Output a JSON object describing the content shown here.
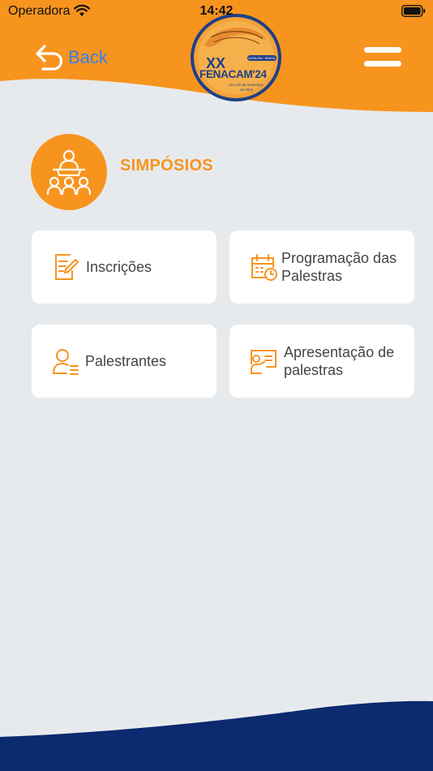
{
  "status_bar": {
    "carrier": "Operadora",
    "time": "14:42"
  },
  "nav": {
    "back_label": "Back"
  },
  "logo": {
    "numeral": "XX",
    "name": "FENACAM'24",
    "dates": "13 a 22 de novembro",
    "year": "de 2024",
    "badge": "NATAL/RN · BRASIL"
  },
  "section": {
    "title": "SIMPÓSIOS"
  },
  "cards": [
    {
      "label": "Inscrições"
    },
    {
      "label": "Programação das Palestras"
    },
    {
      "label": "Palestrantes"
    },
    {
      "label": "Apresentação de palestras"
    }
  ],
  "colors": {
    "accent": "#f7941e",
    "link": "#3a7ee8",
    "footer": "#0b2a6f",
    "background": "#e7eaed"
  }
}
